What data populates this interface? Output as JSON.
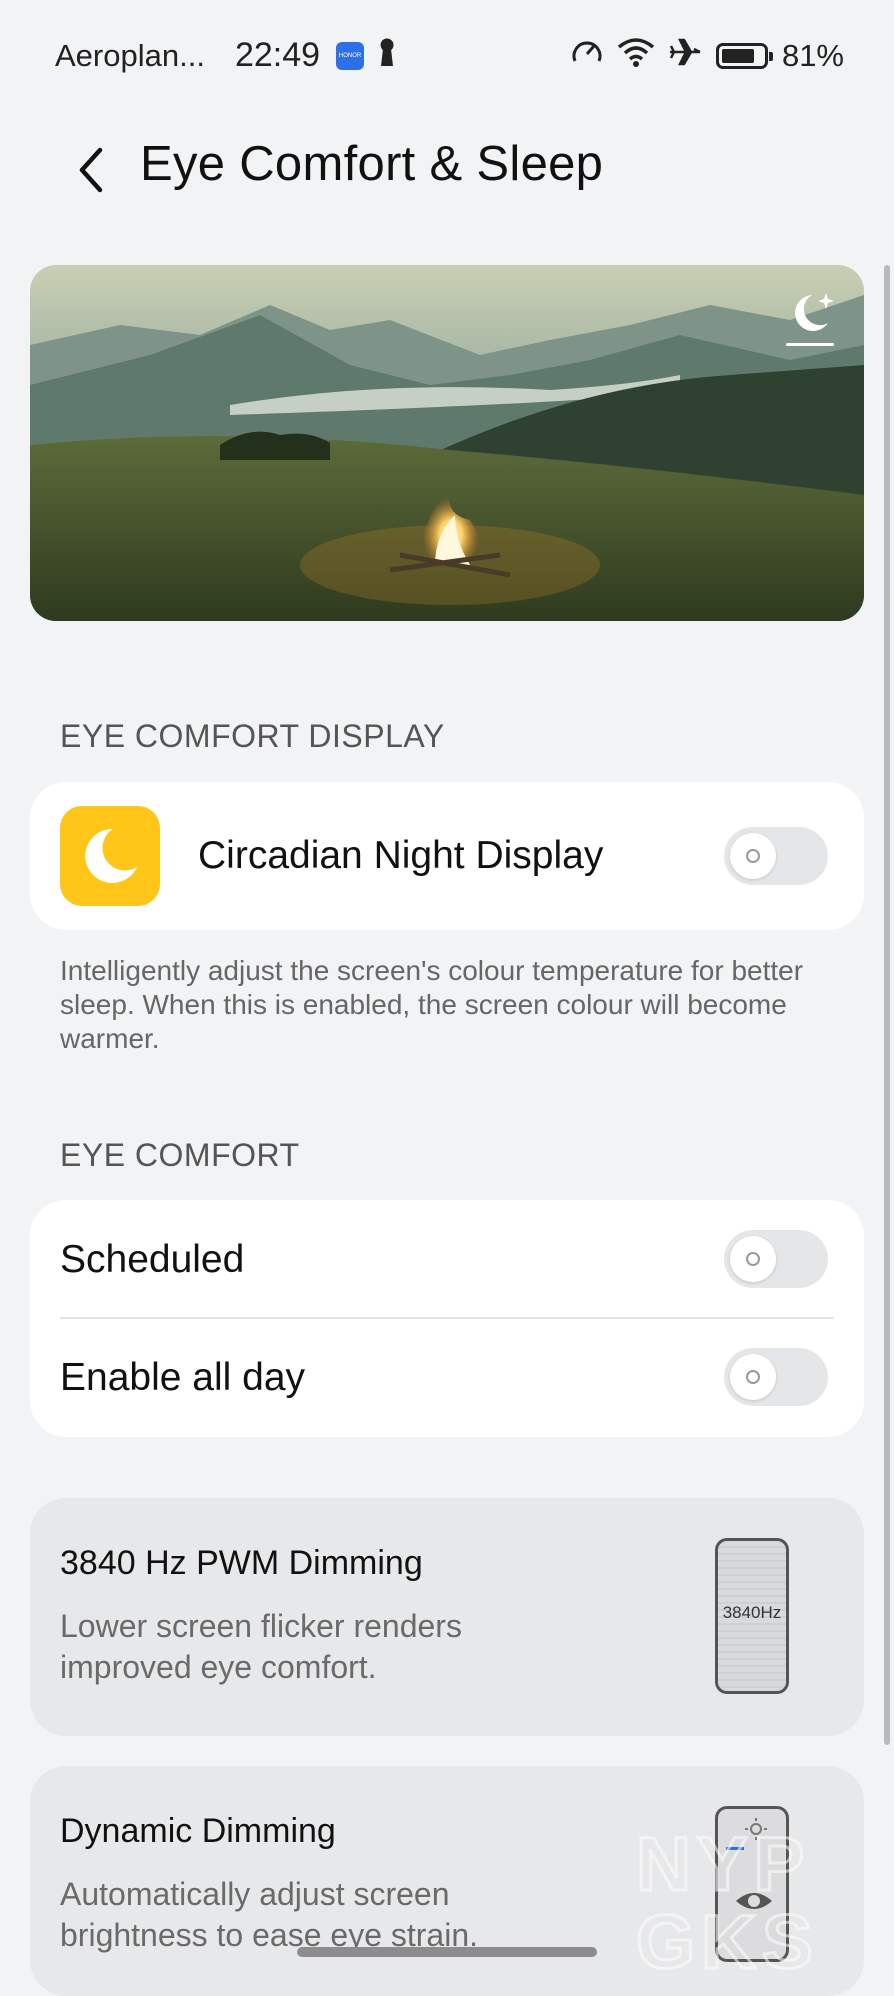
{
  "status_bar": {
    "carrier": "Aeroplan...",
    "time": "22:49",
    "honor_badge": "HONOR",
    "battery_percent": "81%",
    "battery_level": 0.81
  },
  "header": {
    "title": "Eye Comfort & Sleep"
  },
  "eye_comfort_display": {
    "section_title": "EYE COMFORT DISPLAY",
    "circadian_label": "Circadian Night Display",
    "circadian_enabled": false,
    "description": "Intelligently adjust the screen's colour temperature for better sleep. When this is enabled, the screen colour will become warmer."
  },
  "eye_comfort": {
    "section_title": "EYE COMFORT",
    "scheduled_label": "Scheduled",
    "scheduled_enabled": false,
    "all_day_label": "Enable all day",
    "all_day_enabled": false
  },
  "pwm_card": {
    "title": "3840 Hz PWM Dimming",
    "description": "Lower screen flicker renders improved eye comfort.",
    "illustration_text": "3840Hz"
  },
  "dynamic_card": {
    "title": "Dynamic Dimming",
    "description": "Automatically adjust screen brightness to ease eye strain."
  },
  "watermark": {
    "line1": "NYP",
    "line2": "GKS"
  },
  "colors": {
    "background": "#f1f3f5",
    "card": "#ffffff",
    "feature_card": "#e7e8ea",
    "accent_yellow": "#ffc619",
    "toggle_off": "#e5e6e8"
  }
}
